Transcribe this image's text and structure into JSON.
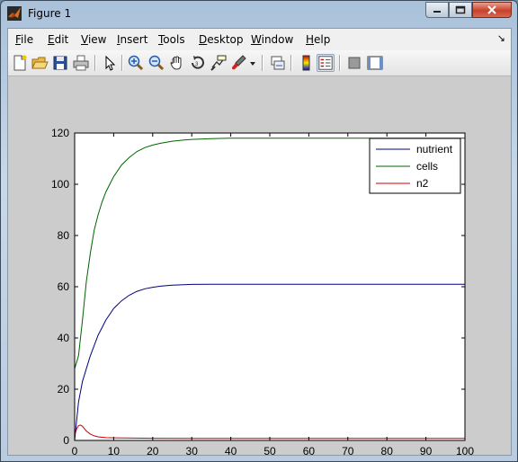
{
  "window": {
    "title": "Figure 1"
  },
  "menu": {
    "items": [
      {
        "pre": "",
        "acc": "F",
        "post": "ile"
      },
      {
        "pre": "",
        "acc": "E",
        "post": "dit"
      },
      {
        "pre": "",
        "acc": "V",
        "post": "iew"
      },
      {
        "pre": "",
        "acc": "I",
        "post": "nsert"
      },
      {
        "pre": "",
        "acc": "T",
        "post": "ools"
      },
      {
        "pre": "",
        "acc": "D",
        "post": "esktop"
      },
      {
        "pre": "",
        "acc": "W",
        "post": "indow"
      },
      {
        "pre": "",
        "acc": "H",
        "post": "elp"
      }
    ],
    "dock_glyph": "↘"
  },
  "toolbar": {
    "icons": [
      "new-figure-icon",
      "open-file-icon",
      "save-icon",
      "print-icon",
      "pointer-icon",
      "zoom-in-icon",
      "zoom-out-icon",
      "pan-hand-icon",
      "rotate-3d-icon",
      "data-cursor-icon",
      "brush-icon",
      "brush-dropdown-icon",
      "link-plot-icon",
      "colorbar-icon",
      "legend-icon",
      "hide-plot-tools-icon",
      "show-plot-tools-icon"
    ]
  },
  "chart_data": {
    "type": "line",
    "title": "",
    "xlabel": "",
    "ylabel": "",
    "xlim": [
      0,
      100
    ],
    "ylim": [
      0,
      120
    ],
    "xticks": [
      0,
      10,
      20,
      30,
      40,
      50,
      60,
      70,
      80,
      90,
      100
    ],
    "yticks": [
      0,
      20,
      40,
      60,
      80,
      100,
      120
    ],
    "grid": false,
    "legend_position": "top-right",
    "series": [
      {
        "name": "nutrient",
        "color": "#000080",
        "x": [
          0,
          1,
          2,
          3,
          4,
          5,
          6,
          7,
          8,
          10,
          12,
          14,
          16,
          18,
          20,
          22,
          25,
          28,
          30,
          35,
          40,
          50,
          60,
          70,
          80,
          90,
          100
        ],
        "y": [
          0,
          15,
          23,
          28,
          33,
          37,
          41,
          44,
          47,
          51.5,
          54.5,
          56.7,
          58.2,
          59.2,
          59.8,
          60.2,
          60.6,
          60.8,
          60.9,
          61,
          61,
          61,
          61,
          61,
          61,
          61,
          61
        ]
      },
      {
        "name": "cells",
        "color": "#006400",
        "x": [
          0,
          1,
          2,
          3,
          4,
          5,
          6,
          7,
          8,
          10,
          12,
          14,
          16,
          18,
          20,
          22,
          25,
          28,
          30,
          35,
          40,
          50,
          60,
          70,
          80,
          90,
          100
        ],
        "y": [
          28,
          33,
          47,
          62,
          73,
          82,
          88,
          93,
          97,
          103,
          107.5,
          110.5,
          112.8,
          114.3,
          115.3,
          116,
          116.8,
          117.3,
          117.5,
          117.8,
          118,
          118,
          118,
          118,
          118,
          118,
          118
        ]
      },
      {
        "name": "n2",
        "color": "#cc0000",
        "x": [
          0,
          0.5,
          1,
          1.5,
          2,
          2.5,
          3,
          4,
          5,
          6,
          8,
          10,
          15,
          20,
          30,
          40,
          50,
          60,
          70,
          80,
          90,
          100
        ],
        "y": [
          2,
          4.5,
          5.8,
          6,
          5.5,
          4.6,
          3.7,
          2.5,
          1.8,
          1.4,
          1.1,
          1.0,
          0.9,
          0.85,
          0.8,
          0.8,
          0.8,
          0.8,
          0.8,
          0.8,
          0.8,
          0.8
        ]
      }
    ]
  }
}
